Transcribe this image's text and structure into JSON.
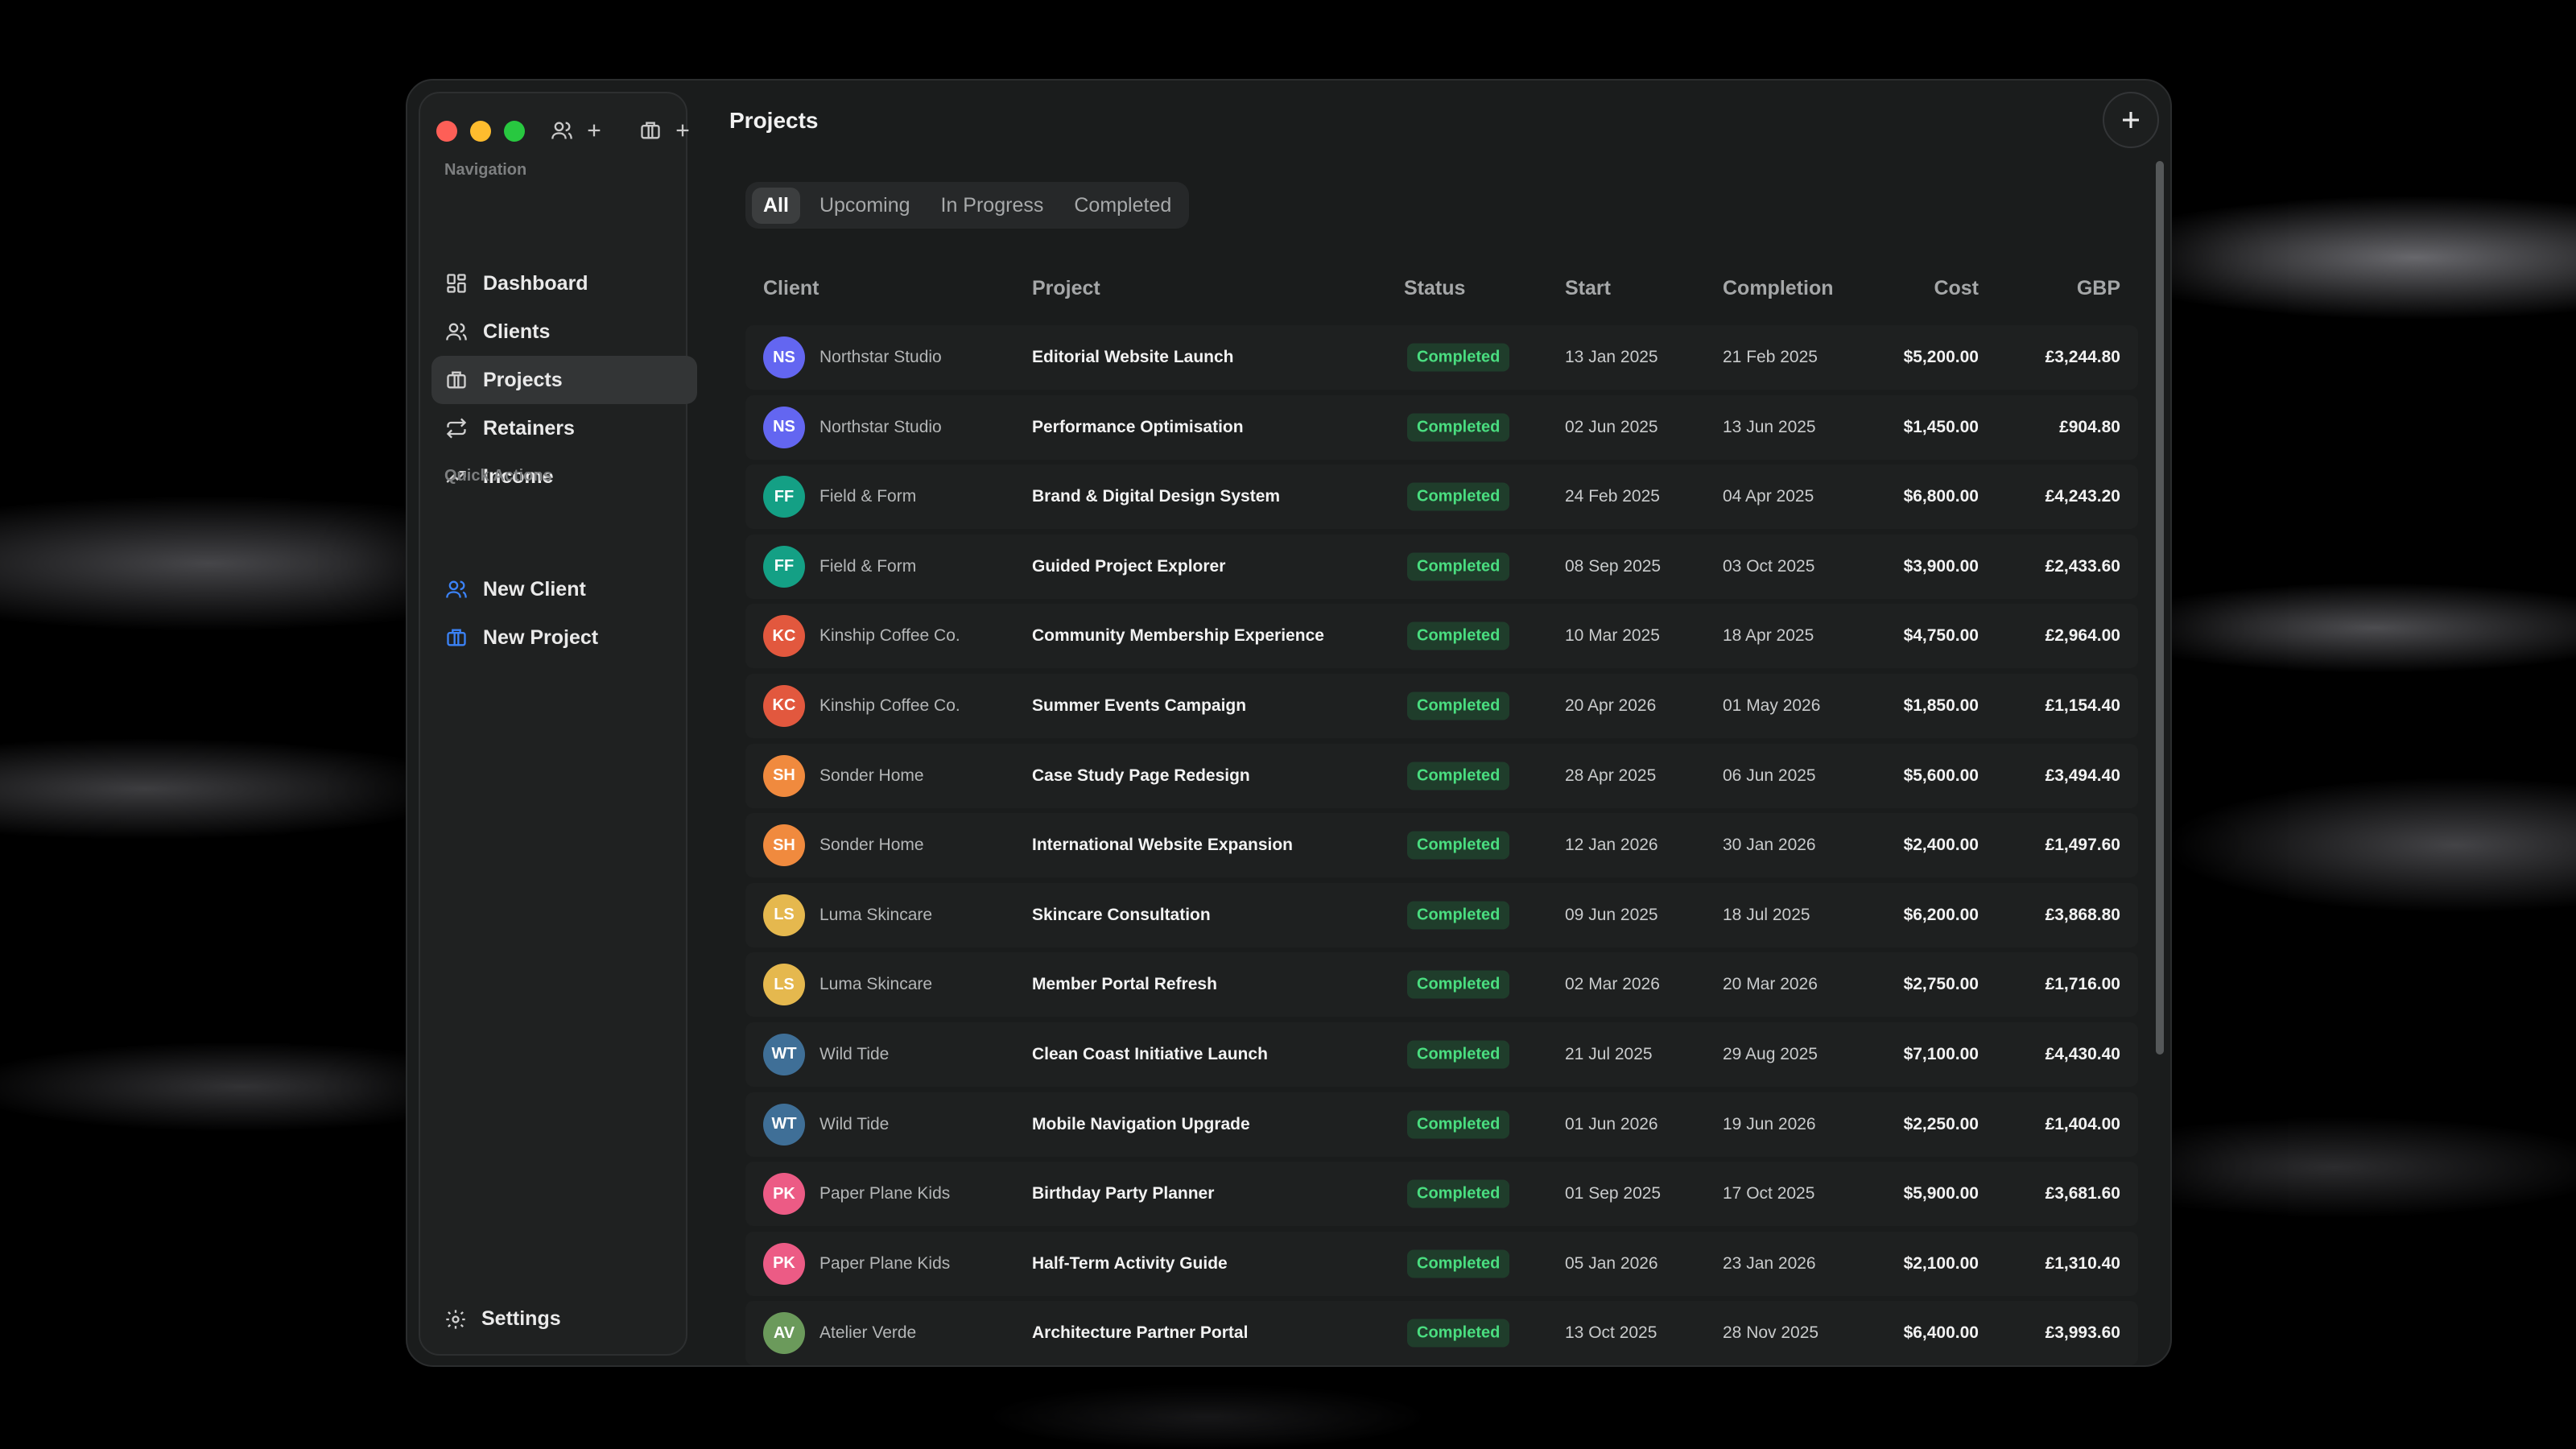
{
  "sidebar": {
    "nav_section": "Navigation",
    "nav_items": [
      {
        "label": "Dashboard",
        "icon": "dashboard-grid-icon"
      },
      {
        "label": "Clients",
        "icon": "users-icon"
      },
      {
        "label": "Projects",
        "icon": "briefcase-icon",
        "active": true
      },
      {
        "label": "Retainers",
        "icon": "repeat-arrows-icon"
      },
      {
        "label": "Income",
        "icon": "trending-up-icon"
      }
    ],
    "quick_section": "Quick Actions",
    "quick_items": [
      {
        "label": "New Client",
        "icon": "users-icon"
      },
      {
        "label": "New Project",
        "icon": "briefcase-icon"
      }
    ],
    "settings_label": "Settings"
  },
  "header": {
    "title": "Projects"
  },
  "tabs": [
    "All",
    "Upcoming",
    "In Progress",
    "Completed"
  ],
  "active_tab": "All",
  "columns": [
    "Client",
    "Project",
    "Status",
    "Start",
    "Completion",
    "Cost",
    "GBP"
  ],
  "rows": [
    {
      "initials": "NS",
      "color": "#6366f1",
      "client": "Northstar Studio",
      "project": "Editorial Website Launch",
      "status": "Completed",
      "start": "13 Jan 2025",
      "completion": "21 Feb 2025",
      "cost": "$5,200.00",
      "gbp": "£3,244.80"
    },
    {
      "initials": "NS",
      "color": "#6366f1",
      "client": "Northstar Studio",
      "project": "Performance Optimisation",
      "status": "Completed",
      "start": "02 Jun 2025",
      "completion": "13 Jun 2025",
      "cost": "$1,450.00",
      "gbp": "£904.80"
    },
    {
      "initials": "FF",
      "color": "#14a085",
      "client": "Field & Form",
      "project": "Brand & Digital Design System",
      "status": "Completed",
      "start": "24 Feb 2025",
      "completion": "04 Apr 2025",
      "cost": "$6,800.00",
      "gbp": "£4,243.20"
    },
    {
      "initials": "FF",
      "color": "#14a085",
      "client": "Field & Form",
      "project": "Guided Project Explorer",
      "status": "Completed",
      "start": "08 Sep 2025",
      "completion": "03 Oct 2025",
      "cost": "$3,900.00",
      "gbp": "£2,433.60"
    },
    {
      "initials": "KC",
      "color": "#e2583e",
      "client": "Kinship Coffee Co.",
      "project": "Community Membership Experience",
      "status": "Completed",
      "start": "10 Mar 2025",
      "completion": "18 Apr 2025",
      "cost": "$4,750.00",
      "gbp": "£2,964.00"
    },
    {
      "initials": "KC",
      "color": "#e2583e",
      "client": "Kinship Coffee Co.",
      "project": "Summer Events Campaign",
      "status": "Completed",
      "start": "20 Apr 2026",
      "completion": "01 May 2026",
      "cost": "$1,850.00",
      "gbp": "£1,154.40"
    },
    {
      "initials": "SH",
      "color": "#f08a3e",
      "client": "Sonder Home",
      "project": "Case Study Page Redesign",
      "status": "Completed",
      "start": "28 Apr 2025",
      "completion": "06 Jun 2025",
      "cost": "$5,600.00",
      "gbp": "£3,494.40"
    },
    {
      "initials": "SH",
      "color": "#f08a3e",
      "client": "Sonder Home",
      "project": "International Website Expansion",
      "status": "Completed",
      "start": "12 Jan 2026",
      "completion": "30 Jan 2026",
      "cost": "$2,400.00",
      "gbp": "£1,497.60"
    },
    {
      "initials": "LS",
      "color": "#e5b84e",
      "client": "Luma Skincare",
      "project": "Skincare Consultation",
      "status": "Completed",
      "start": "09 Jun 2025",
      "completion": "18 Jul 2025",
      "cost": "$6,200.00",
      "gbp": "£3,868.80"
    },
    {
      "initials": "LS",
      "color": "#e5b84e",
      "client": "Luma Skincare",
      "project": "Member Portal Refresh",
      "status": "Completed",
      "start": "02 Mar 2026",
      "completion": "20 Mar 2026",
      "cost": "$2,750.00",
      "gbp": "£1,716.00"
    },
    {
      "initials": "WT",
      "color": "#3f6f97",
      "client": "Wild Tide",
      "project": "Clean Coast Initiative Launch",
      "status": "Completed",
      "start": "21 Jul 2025",
      "completion": "29 Aug 2025",
      "cost": "$7,100.00",
      "gbp": "£4,430.40"
    },
    {
      "initials": "WT",
      "color": "#3f6f97",
      "client": "Wild Tide",
      "project": "Mobile Navigation Upgrade",
      "status": "Completed",
      "start": "01 Jun 2026",
      "completion": "19 Jun 2026",
      "cost": "$2,250.00",
      "gbp": "£1,404.00"
    },
    {
      "initials": "PK",
      "color": "#ec5b85",
      "client": "Paper Plane Kids",
      "project": "Birthday Party Planner",
      "status": "Completed",
      "start": "01 Sep 2025",
      "completion": "17 Oct 2025",
      "cost": "$5,900.00",
      "gbp": "£3,681.60"
    },
    {
      "initials": "PK",
      "color": "#ec5b85",
      "client": "Paper Plane Kids",
      "project": "Half-Term Activity Guide",
      "status": "Completed",
      "start": "05 Jan 2026",
      "completion": "23 Jan 2026",
      "cost": "$2,100.00",
      "gbp": "£1,310.40"
    },
    {
      "initials": "AV",
      "color": "#6b9a5b",
      "client": "Atelier Verde",
      "project": "Architecture Partner Portal",
      "status": "Completed",
      "start": "13 Oct 2025",
      "completion": "28 Nov 2025",
      "cost": "$6,400.00",
      "gbp": "£3,993.60"
    }
  ]
}
